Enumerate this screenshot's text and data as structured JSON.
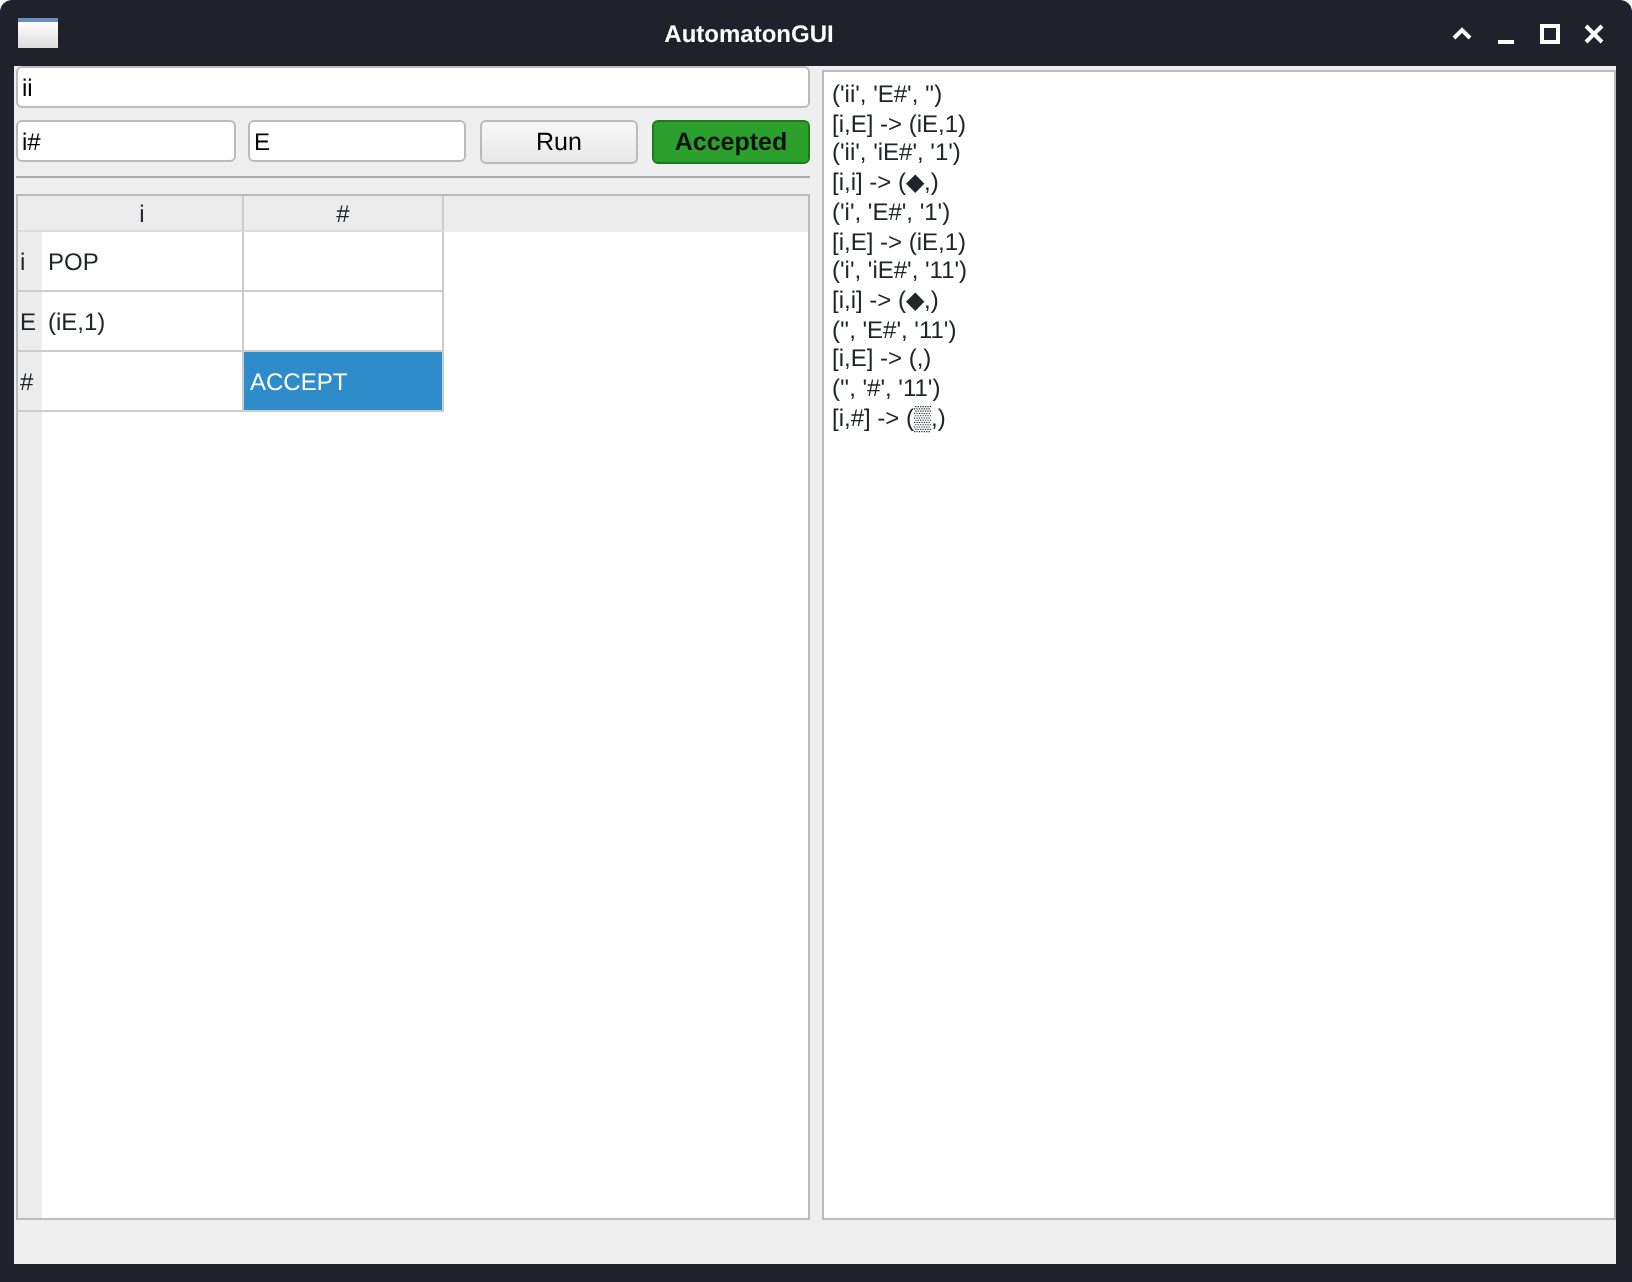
{
  "window": {
    "title": "AutomatonGUI"
  },
  "input_field": {
    "value": "ii"
  },
  "stack_field": {
    "value": "i#"
  },
  "state_field": {
    "value": "E"
  },
  "run_button": {
    "label": "Run"
  },
  "result_button": {
    "label": "Accepted",
    "kind": "accepted"
  },
  "table": {
    "columns": [
      "i",
      "#"
    ],
    "rows": [
      {
        "header": "i",
        "cells": [
          {
            "text": "POP",
            "selected": false
          },
          {
            "text": "",
            "selected": false
          }
        ]
      },
      {
        "header": "E",
        "cells": [
          {
            "text": "(iE,1)",
            "selected": false
          },
          {
            "text": "",
            "selected": false
          }
        ]
      },
      {
        "header": "#",
        "cells": [
          {
            "text": "",
            "selected": false
          },
          {
            "text": "ACCEPT",
            "selected": true
          }
        ]
      }
    ]
  },
  "log": [
    "('ii', 'E#', '')",
    "[i,E] -> (iE,1)",
    "('ii', 'iE#', '1')",
    "[i,i] -> (◆,)",
    "('i', 'E#', '1')",
    "[i,E] -> (iE,1)",
    "('i', 'iE#', '11')",
    "[i,i] -> (◆,)",
    "('', 'E#', '11')",
    "[i,E] -> (,)",
    "('', '#', '11')",
    "[i,#] -> (▒,)"
  ]
}
